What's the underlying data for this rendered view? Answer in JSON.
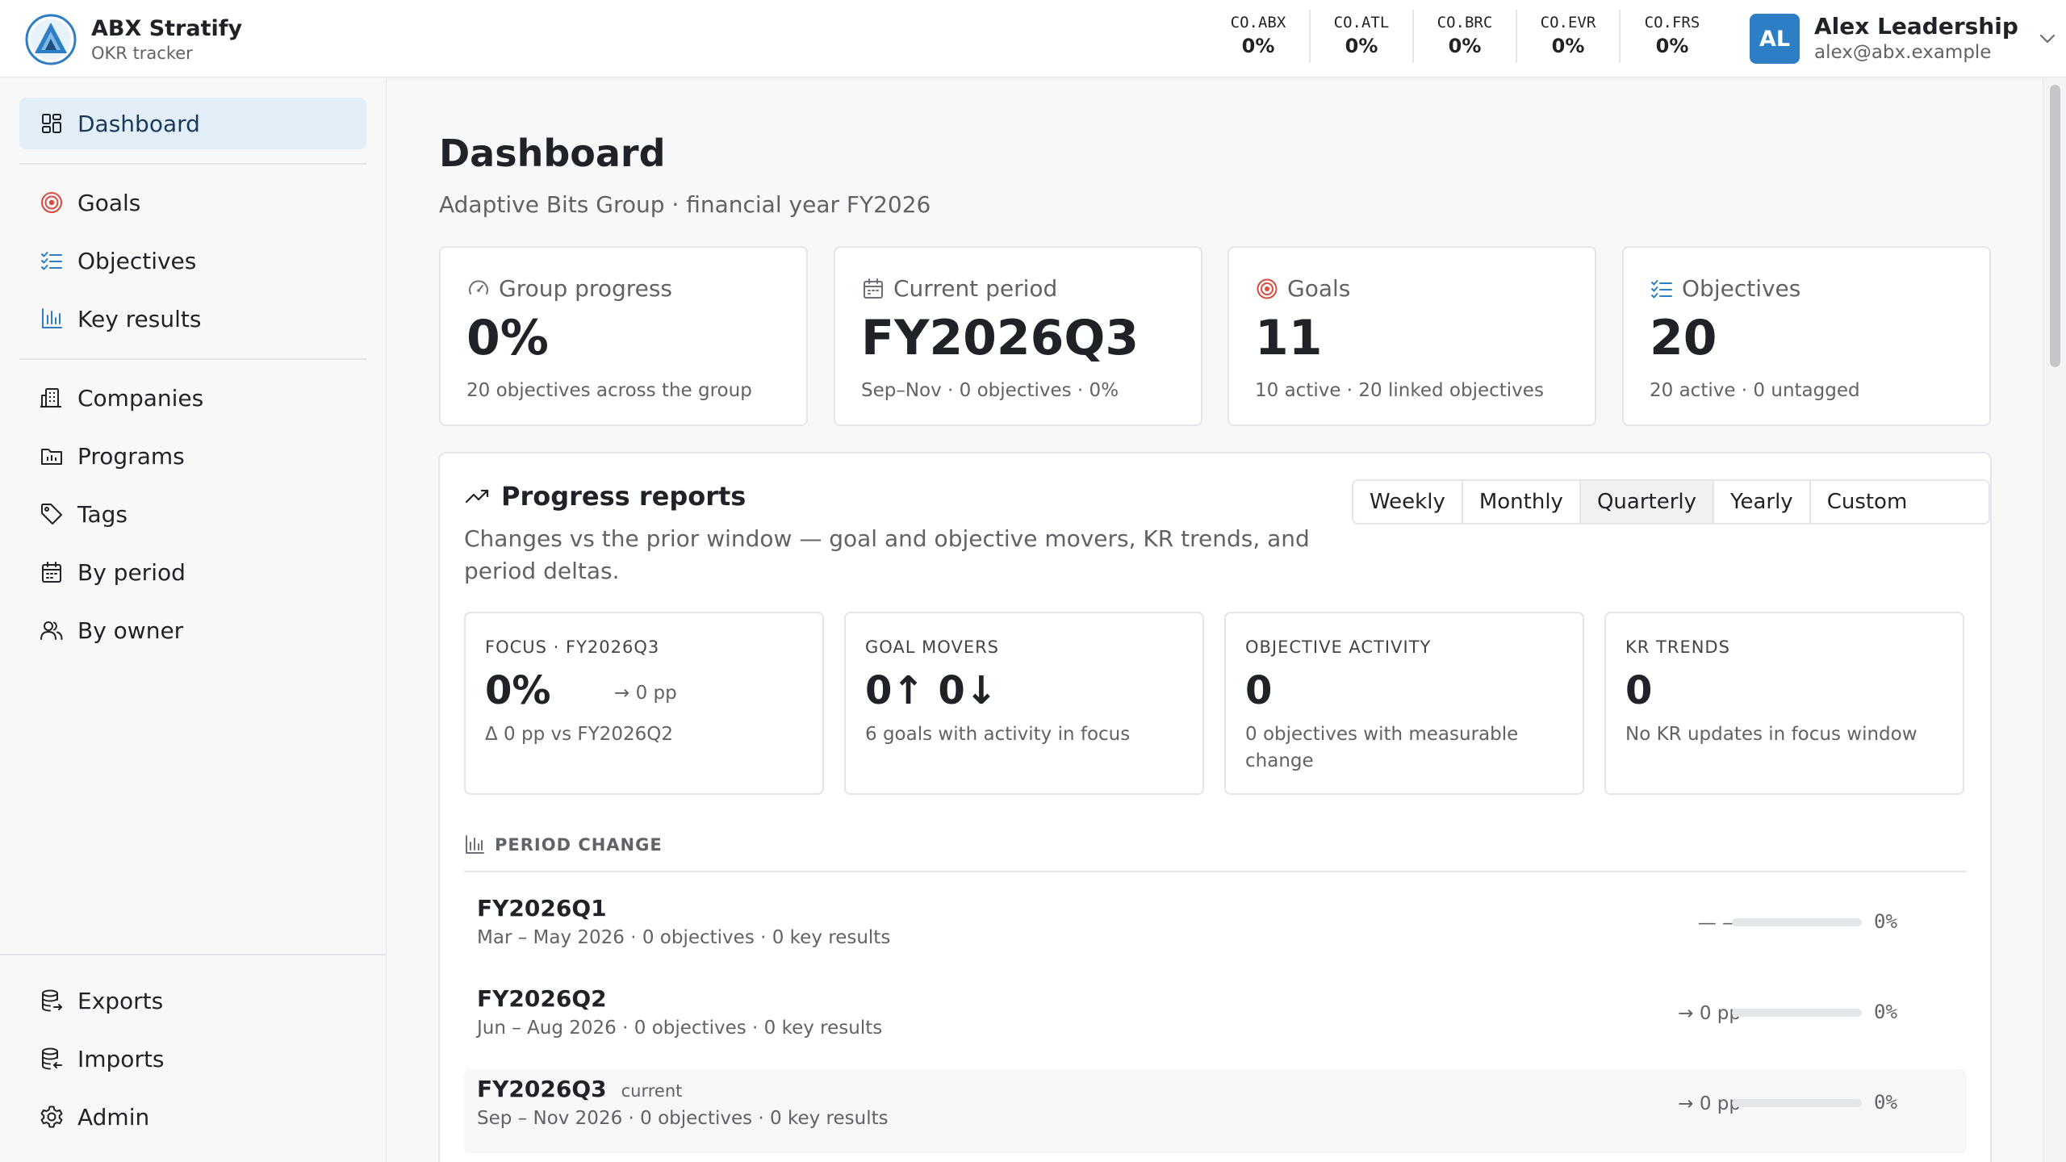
{
  "app": {
    "name": "ABX Stratify",
    "subtitle": "OKR tracker"
  },
  "tickers": [
    {
      "code": "CO.ABX",
      "value": "0%"
    },
    {
      "code": "CO.ATL",
      "value": "0%"
    },
    {
      "code": "CO.BRC",
      "value": "0%"
    },
    {
      "code": "CO.EVR",
      "value": "0%"
    },
    {
      "code": "CO.FRS",
      "value": "0%"
    }
  ],
  "user": {
    "initials": "AL",
    "name": "Alex Leadership",
    "email": "alex@abx.example"
  },
  "sidebar": {
    "items": [
      {
        "label": "Dashboard",
        "icon": "dashboard-icon",
        "active": true
      },
      {
        "label": "Goals",
        "icon": "target-icon"
      },
      {
        "label": "Objectives",
        "icon": "checklist-icon"
      },
      {
        "label": "Key results",
        "icon": "bar-chart-icon"
      },
      {
        "label": "Companies",
        "icon": "building-icon"
      },
      {
        "label": "Programs",
        "icon": "folder-icon"
      },
      {
        "label": "Tags",
        "icon": "tag-icon"
      },
      {
        "label": "By period",
        "icon": "calendar-icon"
      },
      {
        "label": "By owner",
        "icon": "users-icon"
      }
    ],
    "bottom_items": [
      {
        "label": "Exports",
        "icon": "database-export-icon"
      },
      {
        "label": "Imports",
        "icon": "database-import-icon"
      },
      {
        "label": "Admin",
        "icon": "gear-icon"
      }
    ]
  },
  "main": {
    "title": "Dashboard",
    "subtitle": "Adaptive Bits Group · financial year FY2026",
    "stats": [
      {
        "label": "Group progress",
        "icon": "gauge-icon",
        "value": "0%",
        "sub": "20 objectives across the group"
      },
      {
        "label": "Current period",
        "icon": "calendar-icon",
        "value": "FY2026Q3",
        "sub": "Sep–Nov · 0 objectives · 0%"
      },
      {
        "label": "Goals",
        "icon": "target-icon",
        "value": "11",
        "sub": "10 active · 20 linked objectives"
      },
      {
        "label": "Objectives",
        "icon": "checklist-icon",
        "value": "20",
        "sub": "20 active · 0 untagged"
      }
    ],
    "reports": {
      "title": "Progress reports",
      "description": "Changes vs the prior window — goal and objective movers, KR trends, and period deltas.",
      "segments": [
        "Weekly",
        "Monthly",
        "Quarterly",
        "Yearly",
        "Custom Period"
      ],
      "active_segment": "Quarterly",
      "metrics": [
        {
          "label": "FOCUS · FY2026Q3",
          "value": "0%",
          "aside": "→ 0 pp",
          "sub": "Δ 0 pp vs FY2026Q2"
        },
        {
          "label": "GOAL MOVERS",
          "value": "0↑ 0↓",
          "aside": "",
          "sub": "6 goals with activity in focus"
        },
        {
          "label": "OBJECTIVE ACTIVITY",
          "value": "0",
          "aside": "",
          "sub": "0 objectives with measurable change"
        },
        {
          "label": "KR TRENDS",
          "value": "0",
          "aside": "",
          "sub": "No KR updates in focus window"
        }
      ],
      "period_change": {
        "label": "PERIOD CHANGE",
        "rows": [
          {
            "name": "FY2026Q1",
            "tag": "",
            "meta": "Mar – May 2026 · 0 objectives · 0 key results",
            "delta": "— —",
            "progress": 0,
            "pct": "0%"
          },
          {
            "name": "FY2026Q2",
            "tag": "",
            "meta": "Jun – Aug 2026 · 0 objectives · 0 key results",
            "delta": "→ 0 pp",
            "progress": 0,
            "pct": "0%"
          },
          {
            "name": "FY2026Q3",
            "tag": "current",
            "meta": "Sep – Nov 2026 · 0 objectives · 0 key results",
            "delta": "→ 0 pp",
            "progress": 0,
            "pct": "0%"
          }
        ]
      }
    }
  },
  "colors": {
    "accent": "#2d7ec4",
    "active_nav_bg": "#e3eef9",
    "goal_red": "#d94b3f"
  }
}
